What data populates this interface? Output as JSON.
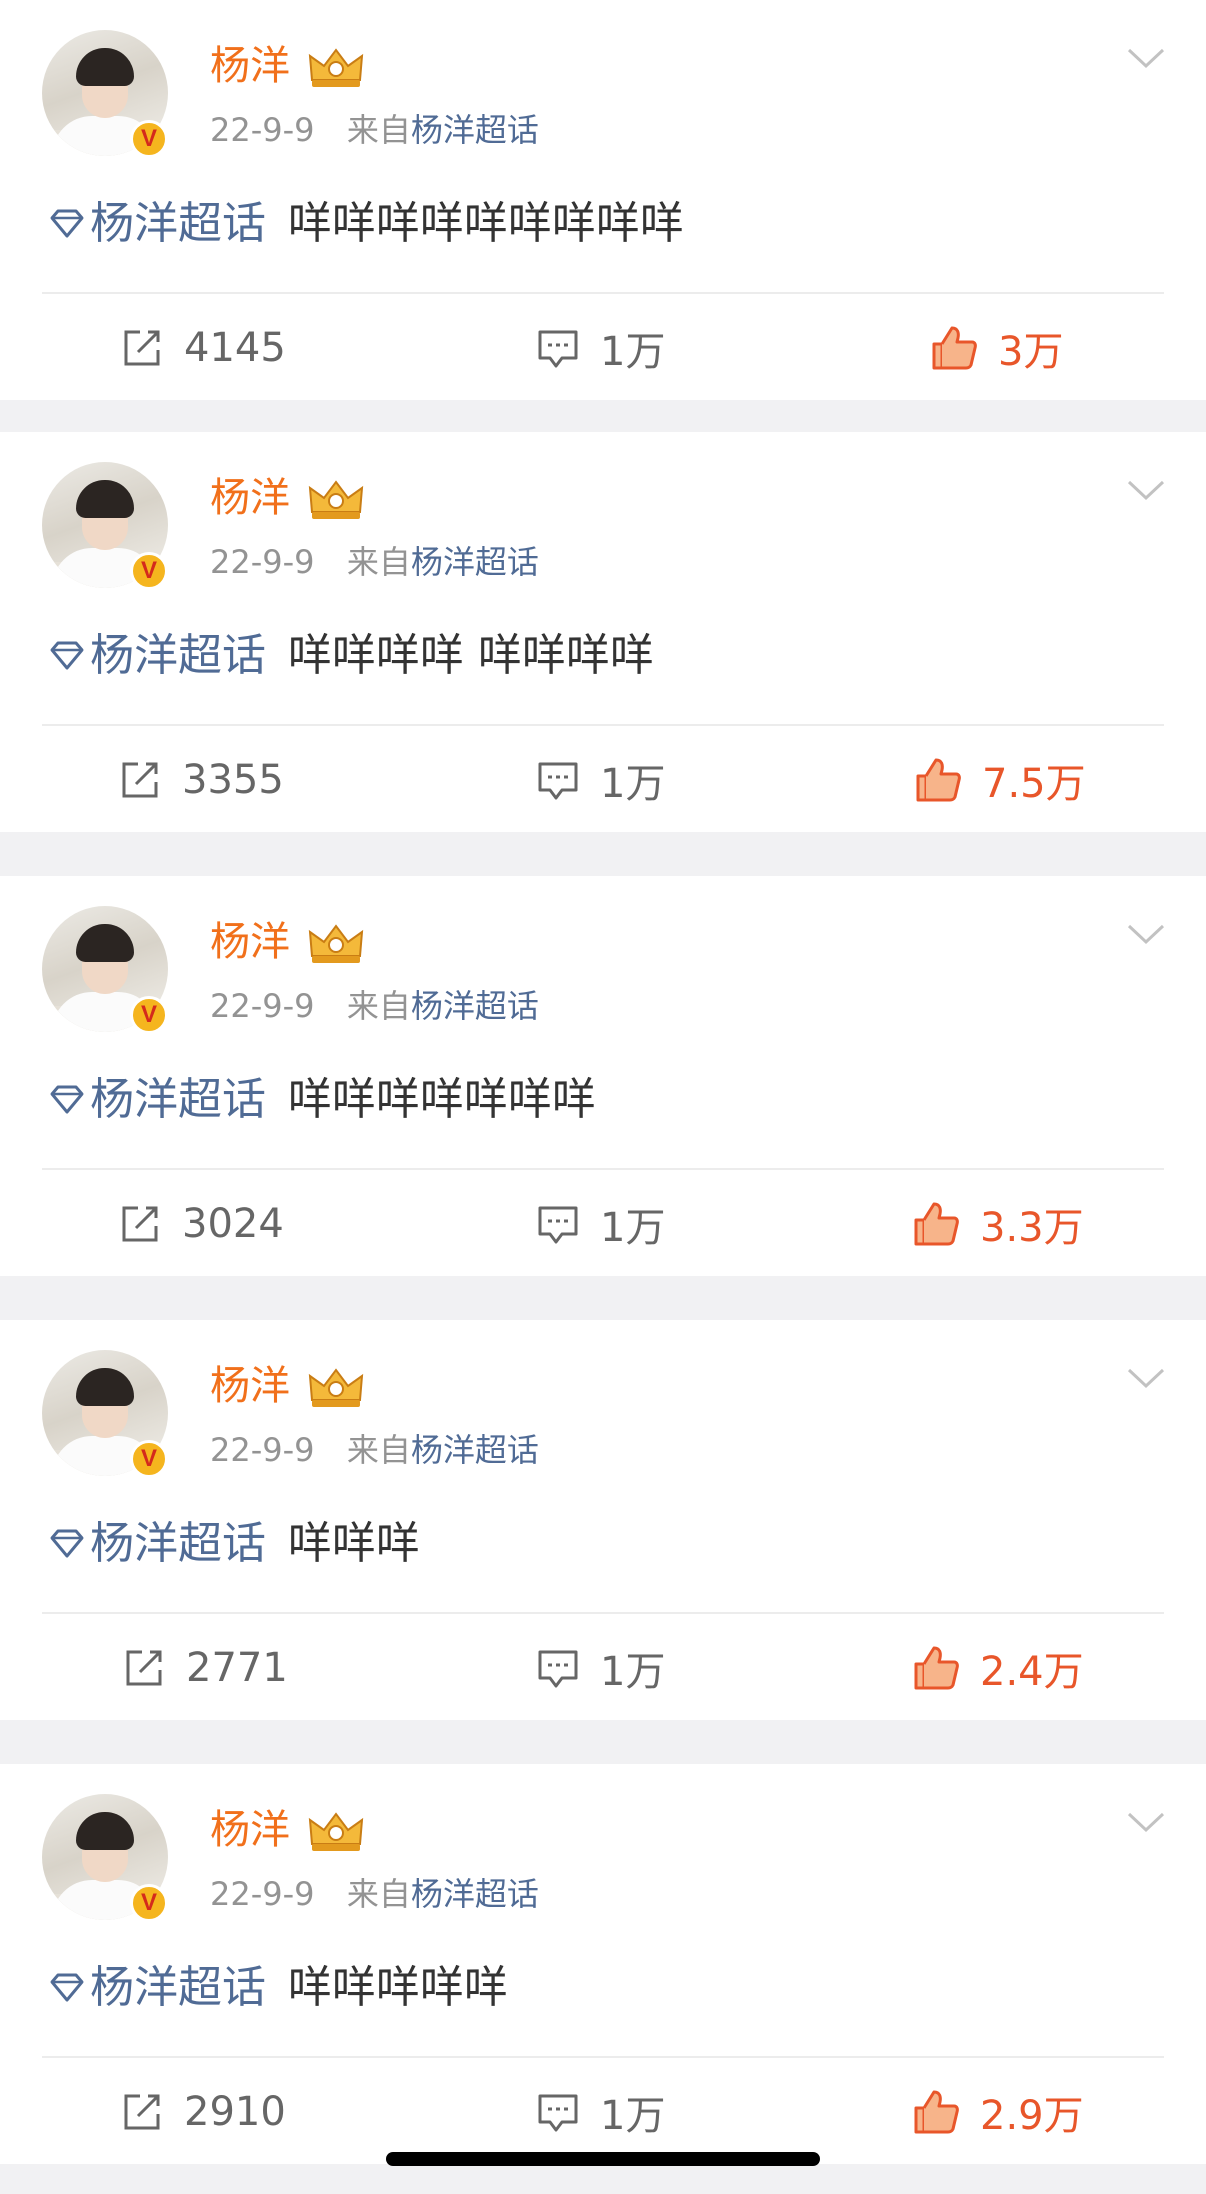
{
  "colors": {
    "accent_name": "#f1701b",
    "link": "#506b95",
    "like": "#e8562a",
    "muted": "#939393",
    "background": "#f1f1f3"
  },
  "posts": [
    {
      "username": "杨洋",
      "date": "22-9-9",
      "via": "来自",
      "source": "杨洋超话",
      "topic": "杨洋超话",
      "text": "咩咩咩咩咩咩咩咩咩",
      "reposts": "4145",
      "comments": "1万",
      "likes": "3万"
    },
    {
      "username": "杨洋",
      "date": "22-9-9",
      "via": "来自",
      "source": "杨洋超话",
      "topic": "杨洋超话",
      "text": "咩咩咩咩 咩咩咩咩",
      "reposts": "3355",
      "comments": "1万",
      "likes": "7.5万"
    },
    {
      "username": "杨洋",
      "date": "22-9-9",
      "via": "来自",
      "source": "杨洋超话",
      "topic": "杨洋超话",
      "text": "咩咩咩咩咩咩咩",
      "reposts": "3024",
      "comments": "1万",
      "likes": "3.3万"
    },
    {
      "username": "杨洋",
      "date": "22-9-9",
      "via": "来自",
      "source": "杨洋超话",
      "topic": "杨洋超话",
      "text": "咩咩咩",
      "reposts": "2771",
      "comments": "1万",
      "likes": "2.4万"
    },
    {
      "username": "杨洋",
      "date": "22-9-9",
      "via": "来自",
      "source": "杨洋超话",
      "topic": "杨洋超话",
      "text": "咩咩咩咩咩",
      "reposts": "2910",
      "comments": "1万",
      "likes": "2.9万"
    }
  ]
}
